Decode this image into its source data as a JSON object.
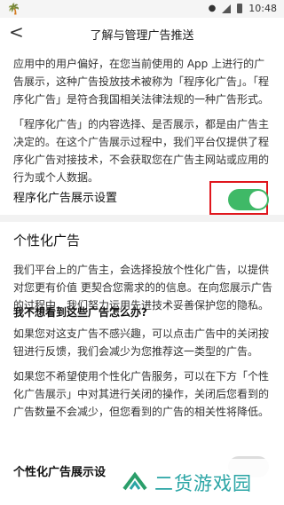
{
  "status_bar": {
    "time": "10:48",
    "left_icon": "palm-tree-icon",
    "icons": [
      "location-icon",
      "wifi-signal-icon",
      "battery-icon"
    ]
  },
  "nav": {
    "back_glyph": "<",
    "title": "了解与管理广告推送"
  },
  "paragraphs": {
    "p1": "应用中的用户偏好，在您当前使用的 App 上进行的广告展示，这种广告投放技术被称为「程序化广告」。「程序化广告」是符合我国相关法律法规的一种广告形式。",
    "p2": "「程序化广告」的内容选择、是否展示，都是由广告主决定的。在这个广告展示过程中，我们平台仅提供了程序化广告对接技术，不会获取您在广告主网站或应用的行为或个人数据。"
  },
  "toggle_row": {
    "label": "程序化广告展示设置",
    "enabled": true,
    "on_color": "#3fb967",
    "highlight_color": "#e0161d"
  },
  "personalized": {
    "title": "个性化广告",
    "p3": "我们平台上的广告主，会选择投放个性化广告，以提供对您更有价值 更契合您需求的的信息。在向您展示广告的过程中，我们努力运用先进技术妥善保护您的隐私。",
    "subheading": "我不想看到这些广告怎么办?",
    "p4": "如果您对这支广告不感兴趣，可以点击广告中的关闭按钮进行反馈，我们会减少为您推荐这一类型的广告。",
    "p5": "如果您不希望使用个性化广告服务，可以在下方「个性化广告展示」中对其进行关闭的操作，关闭后您看到的广告数量不会减少，但您看到的广告的相关性将降低。",
    "section2_title": "个性化广告展示设"
  },
  "watermark": {
    "text": "二货游戏园",
    "color": "#2aa5a5"
  }
}
